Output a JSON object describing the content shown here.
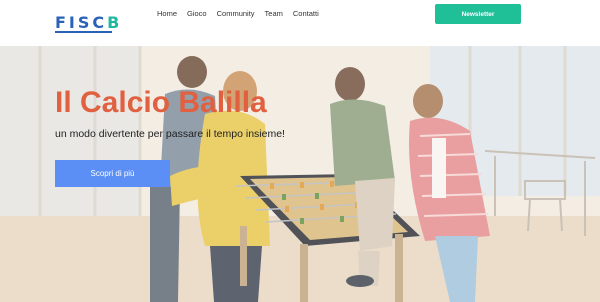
{
  "brand": {
    "logo_main": "FISC",
    "logo_accent": "B"
  },
  "nav": {
    "items": [
      "Home",
      "Gioco",
      "Community",
      "Team",
      "Contatti"
    ]
  },
  "header": {
    "newsletter_label": "Newsletter"
  },
  "hero": {
    "title": "Il Calcio Balilla",
    "subtitle": "un modo divertente per passare il tempo insieme!",
    "cta_label": "Scopri di più"
  },
  "colors": {
    "logo": "#2a62b8",
    "newsletter": "#1fbf98",
    "title": "#e0603f",
    "cta": "#5b8ff5"
  }
}
